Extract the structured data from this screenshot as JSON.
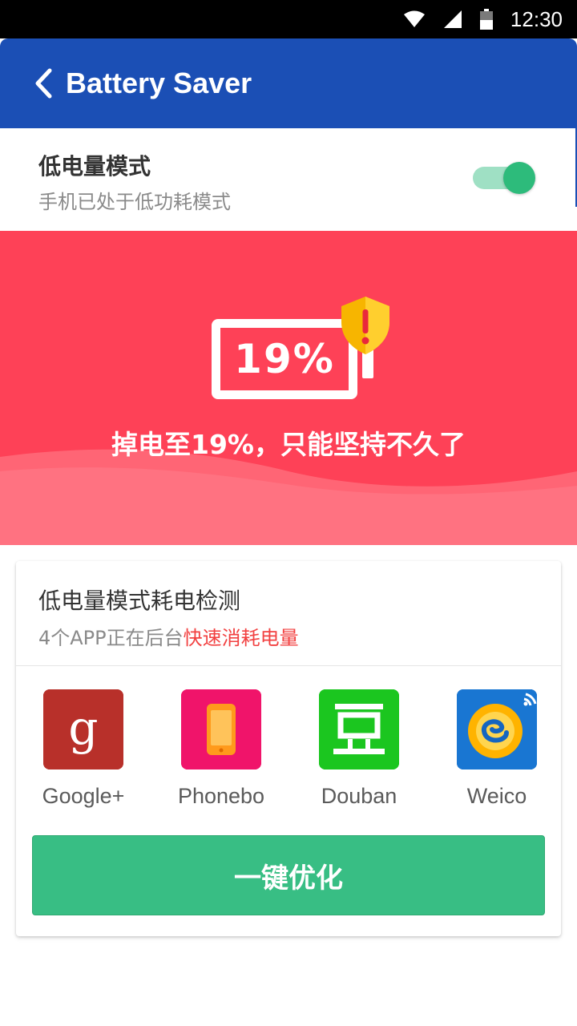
{
  "status_bar": {
    "time": "12:30",
    "icons": [
      "wifi-icon",
      "signal-icon",
      "battery-icon"
    ]
  },
  "app_bar": {
    "title": "Battery Saver",
    "back_icon": "chevron-left-icon",
    "color": "#1b4fb5"
  },
  "low_power_mode": {
    "title": "低电量模式",
    "subtitle": "手机已处于低功耗模式",
    "enabled": true,
    "toggle_color": "#2dbb7b"
  },
  "battery_status": {
    "percent_label": "19%",
    "percent": 19,
    "message": "掉电至19%，只能坚持不久了",
    "warning_icon": "shield-warning-icon",
    "background_color": "#fe4157"
  },
  "detection_card": {
    "title": "低电量模式耗电检测",
    "subtitle_prefix": "4个APP正在后台",
    "subtitle_highlight": "快速消耗电量",
    "highlight_color": "#f24141",
    "apps": [
      {
        "name": "Google+",
        "icon": "google-plus-icon",
        "color": "#b8302a"
      },
      {
        "name": "Phonebo",
        "icon": "phone-icon",
        "color": "#f0146a"
      },
      {
        "name": "Douban",
        "icon": "douban-icon",
        "color": "#1bc61f"
      },
      {
        "name": "Weico",
        "icon": "weico-icon",
        "color": "#1565c0"
      }
    ],
    "optimize_button": "一键优化",
    "button_color": "#38be84"
  }
}
